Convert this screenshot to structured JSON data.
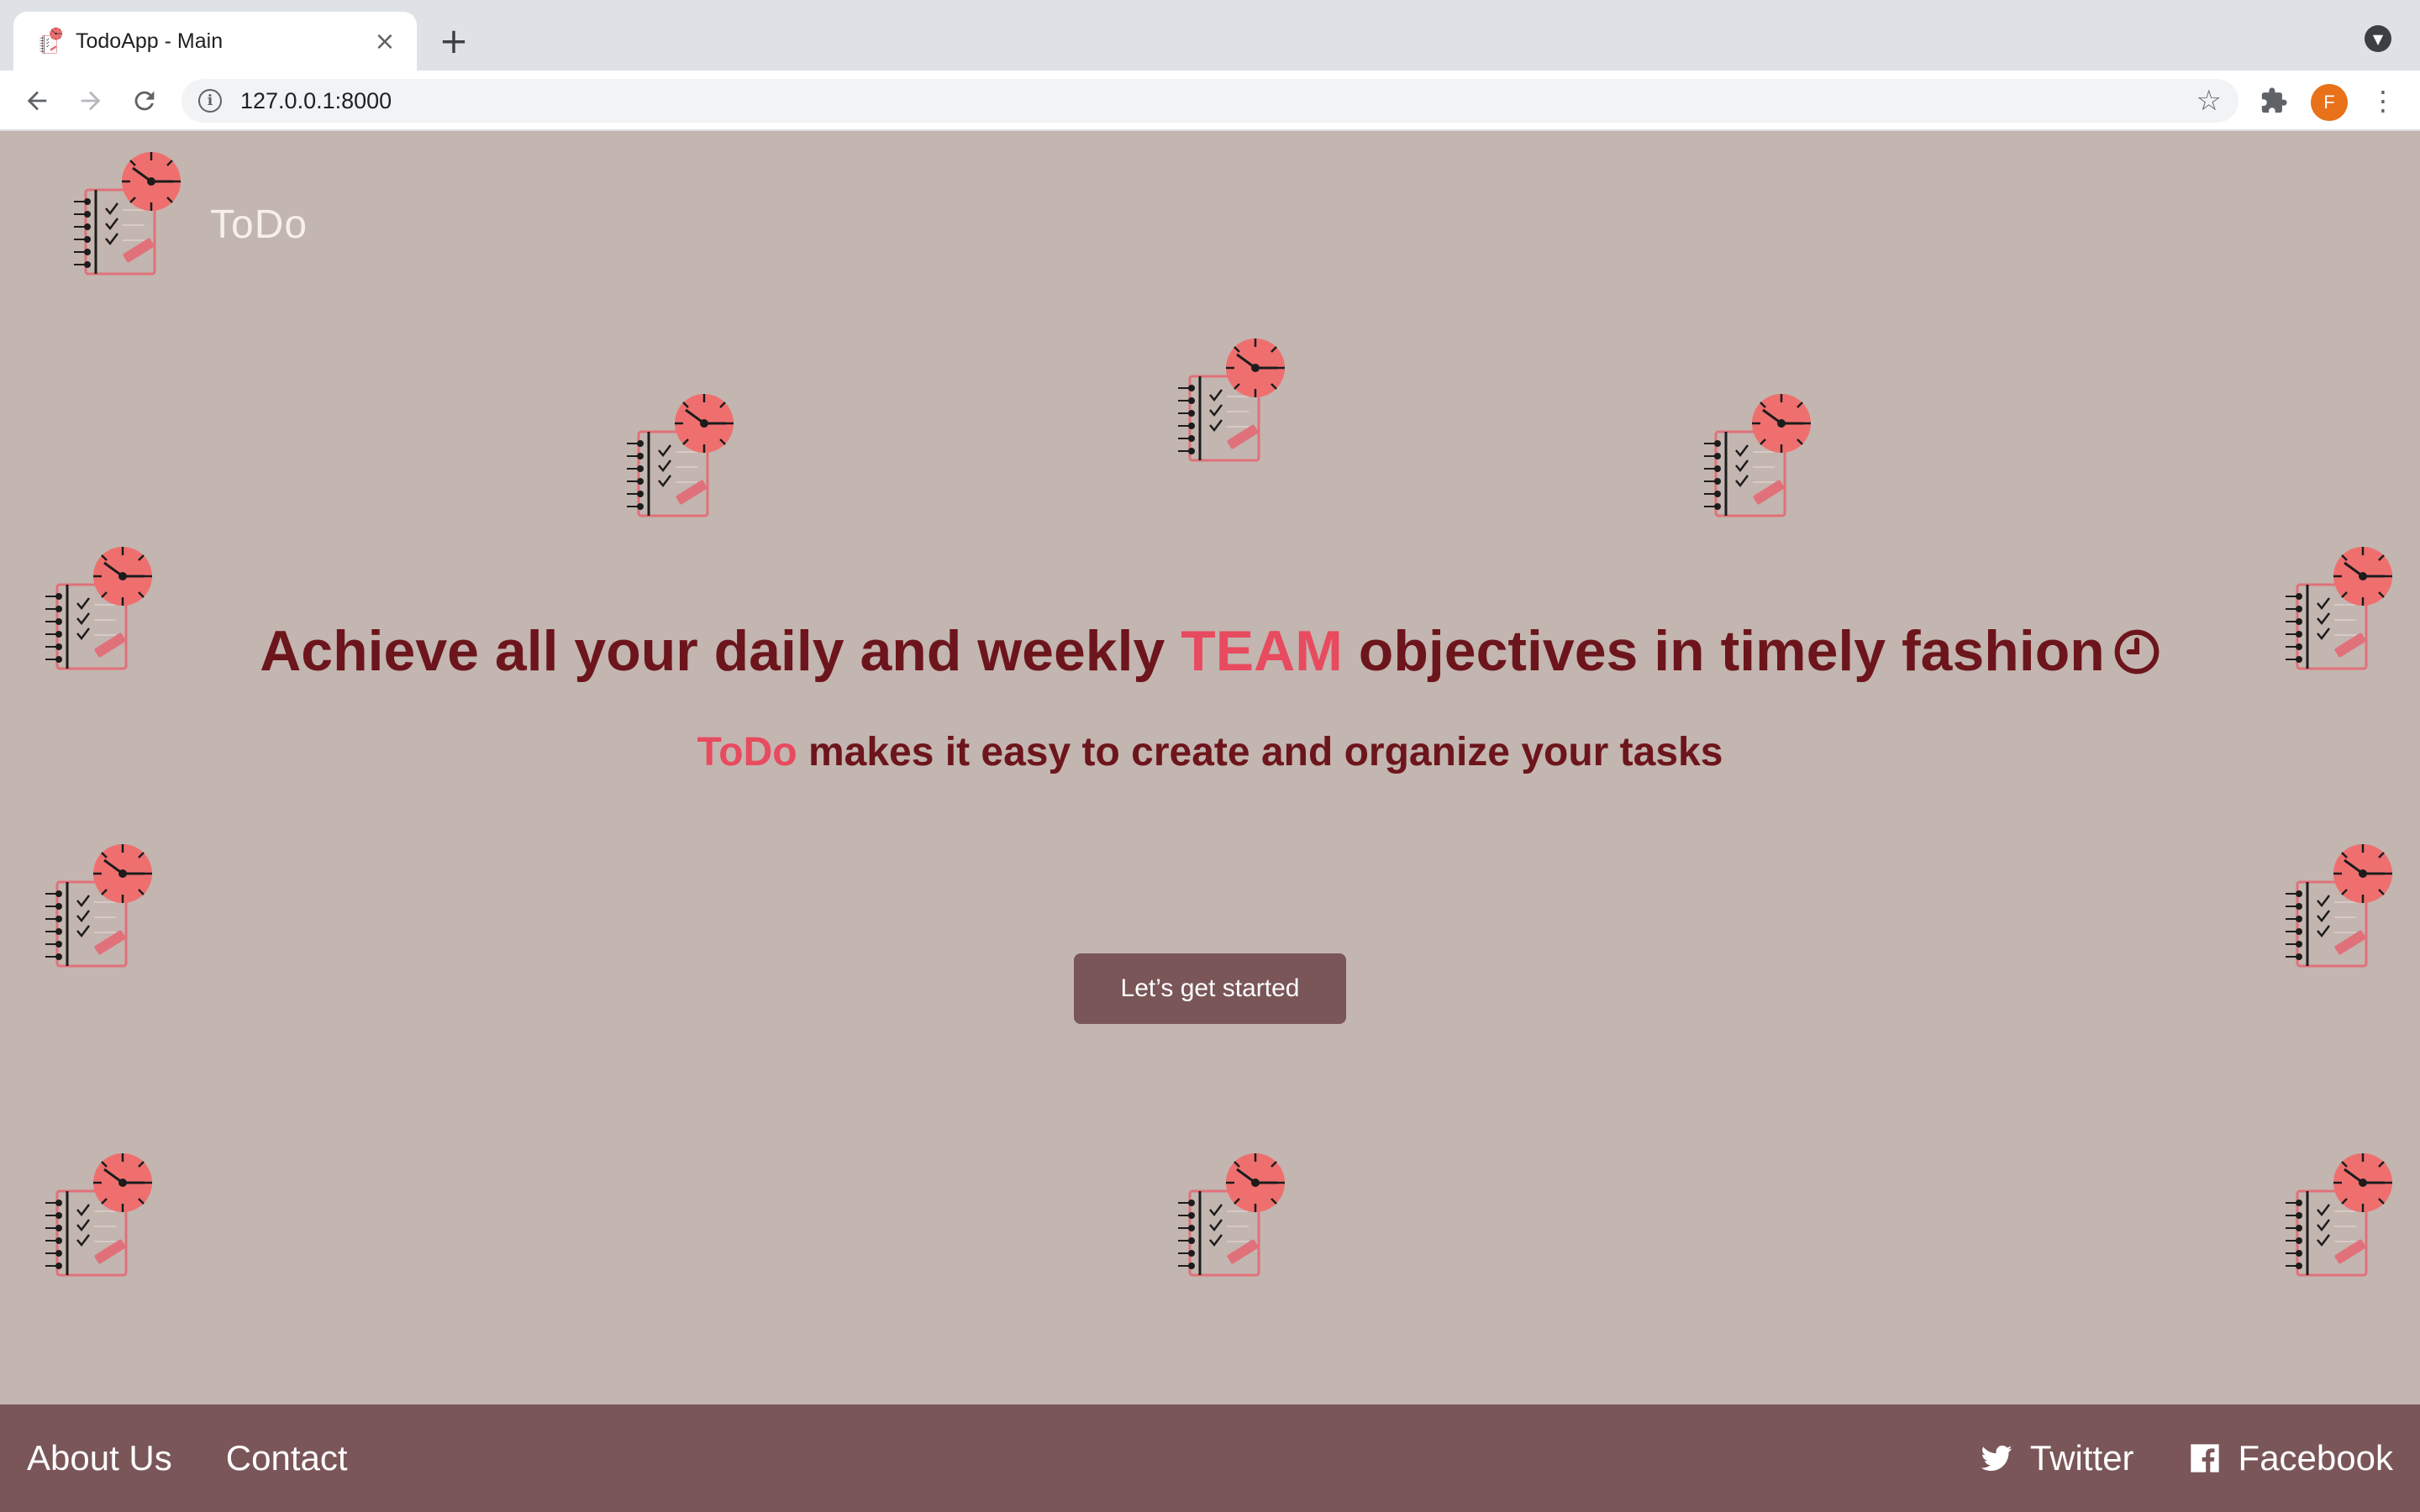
{
  "browser": {
    "tab_title": "TodoApp - Main",
    "tab_close": "×",
    "new_tab": "+",
    "url": "127.0.0.1:8000",
    "profile_initial": "F"
  },
  "header": {
    "brand": "ToDo"
  },
  "hero": {
    "headline_part1": "Achieve all your daily and weekly ",
    "headline_accent": "TEAM",
    "headline_part2": " objectives in timely fashion",
    "subhead_brand": "ToDo",
    "subhead_rest": " makes it easy to create and organize your tasks",
    "cta_label": "Let’s get started"
  },
  "footer": {
    "about_label": "About Us",
    "contact_label": "Contact",
    "twitter_label": "Twitter",
    "facebook_label": "Facebook"
  },
  "colors": {
    "background": "#c3b5af",
    "headline": "#6d151c",
    "accent": "#e84a5f",
    "button": "#7a5659",
    "footer": "#7a5659"
  }
}
